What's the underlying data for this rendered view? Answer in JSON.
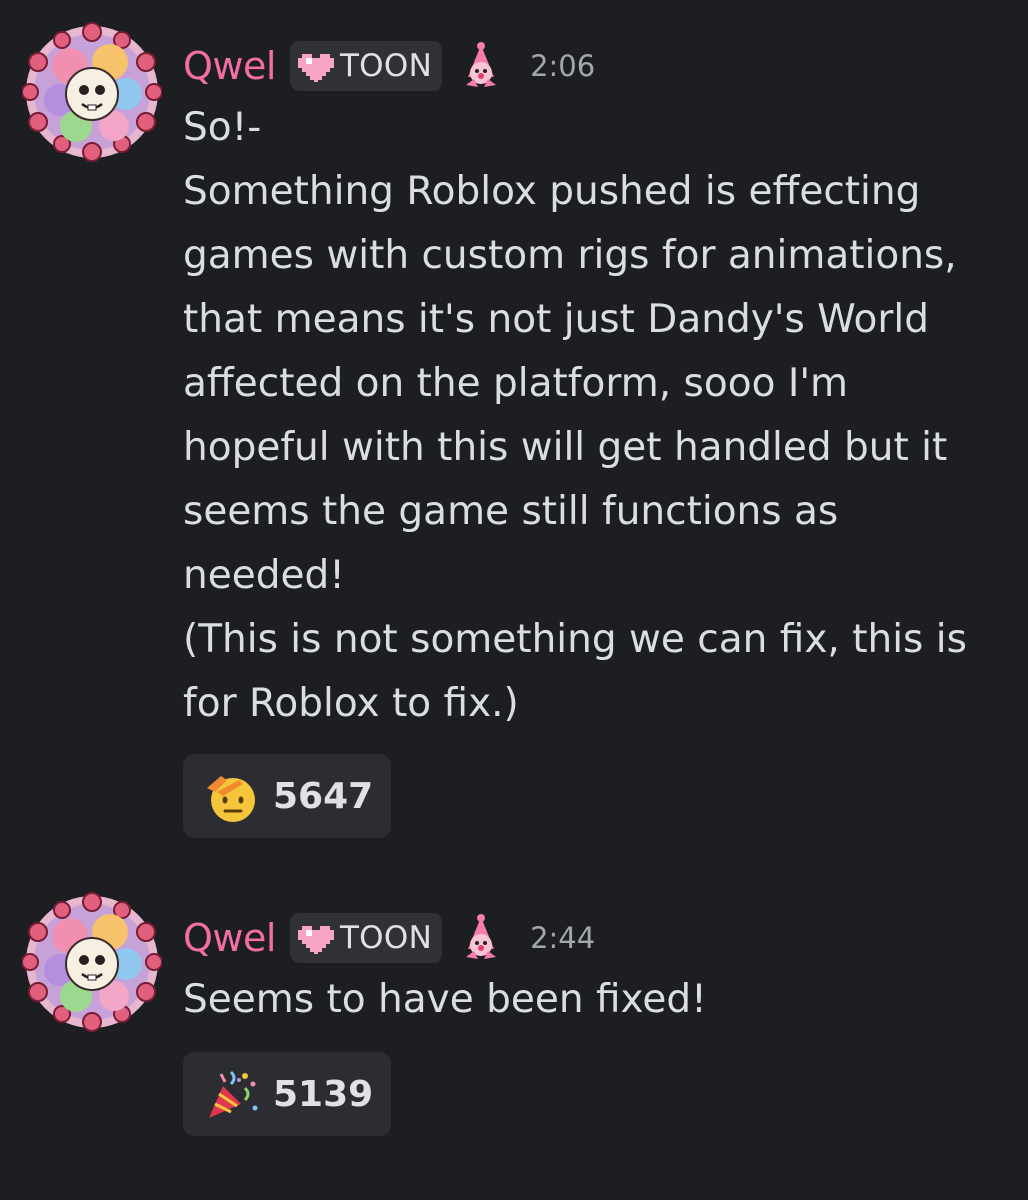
{
  "messages": [
    {
      "author": "Qwel",
      "tag": "TOON",
      "time": "2:06",
      "lines": [
        "So!-",
        "Something Roblox pushed is effecting",
        "games with custom rigs for animations,",
        "that means it's not just Dandy's World",
        "affected on the platform, sooo I'm",
        "hopeful with this will get handled but it",
        "seems the game still functions as",
        "needed!",
        "(This is not something we can fix, this is",
        "for Roblox to fix.)"
      ],
      "reaction": {
        "icon": "saluting-face-icon",
        "count": "5647"
      }
    },
    {
      "author": "Qwel",
      "tag": "TOON",
      "time": "2:44",
      "lines": [
        "Seems to have been fixed!"
      ],
      "reaction": {
        "icon": "party-popper-icon",
        "count": "5139"
      }
    }
  ],
  "colors": {
    "background": "#1d1e22",
    "username": "#f36ea4",
    "tag_bg": "#303136",
    "reaction_bg": "#2c2d32",
    "timestamp": "#a3a6ad",
    "text": "#dbdee1"
  }
}
